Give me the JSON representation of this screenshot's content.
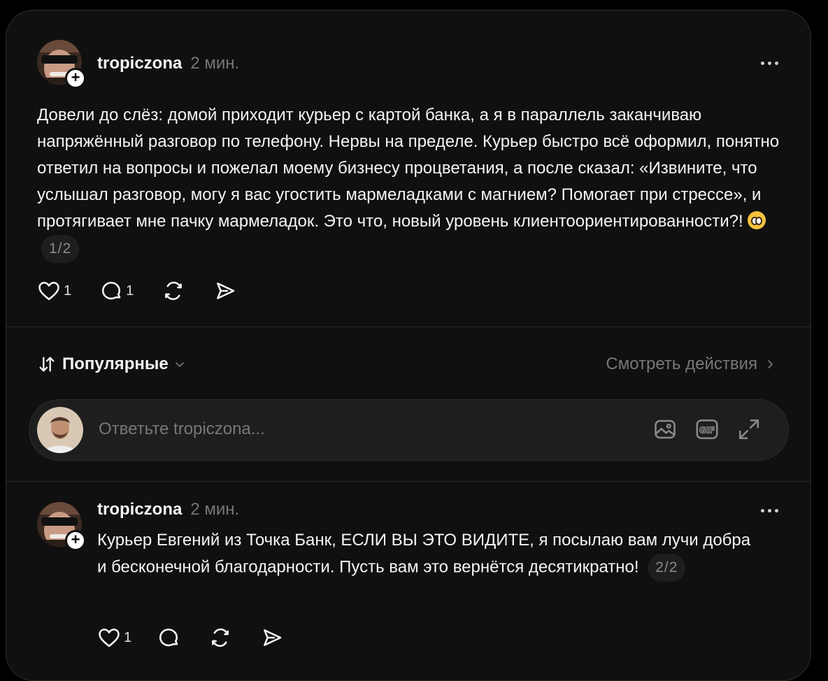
{
  "post": {
    "username": "tropiczona",
    "time": "2 мин.",
    "text": "Довели до слёз: домой приходит курьер с картой банка, а я в параллель заканчиваю напряжённый разговор по телефону. Нервы на пределе. Курьер быстро всё оформил, понятно ответил на вопросы и пожелал моему бизнесу процветания, а после сказал: «Извините, что услышал разговор, могу я вас угостить мармеладками с магнием? Помогает при стрессе», и протягивает мне пачку мармеладок. Это что, новый уровень клиентоориентированности?!",
    "emoji": "pleading-face",
    "pager": "1/2",
    "likes": "1",
    "replies": "1"
  },
  "sort": {
    "label": "Популярные",
    "view_activity": "Смотреть действия"
  },
  "reply_box": {
    "placeholder": "Ответьте tropiczona..."
  },
  "reply": {
    "username": "tropiczona",
    "time": "2 мин.",
    "text": "Курьер Евгений из Точка Банк, ЕСЛИ ВЫ ЭТО ВИДИТЕ, я посылаю вам лучи добра и бесконечной благодарности. Пусть вам это вернётся десятикратно!",
    "pager": "2/2",
    "likes": "1"
  },
  "icons": {
    "like": "heart-icon",
    "comment": "comment-icon",
    "repost": "repost-icon",
    "share": "share-icon",
    "more": "more-dots-icon",
    "sort": "sort-arrows-icon",
    "chevron_down": "chevron-down-icon",
    "chevron_right": "chevron-right-icon",
    "image": "image-icon",
    "gif": "gif-icon",
    "expand": "expand-icon",
    "follow": "plus-icon"
  },
  "colors": {
    "background": "#101010",
    "text": "#f3f5f7",
    "muted": "#777777"
  }
}
